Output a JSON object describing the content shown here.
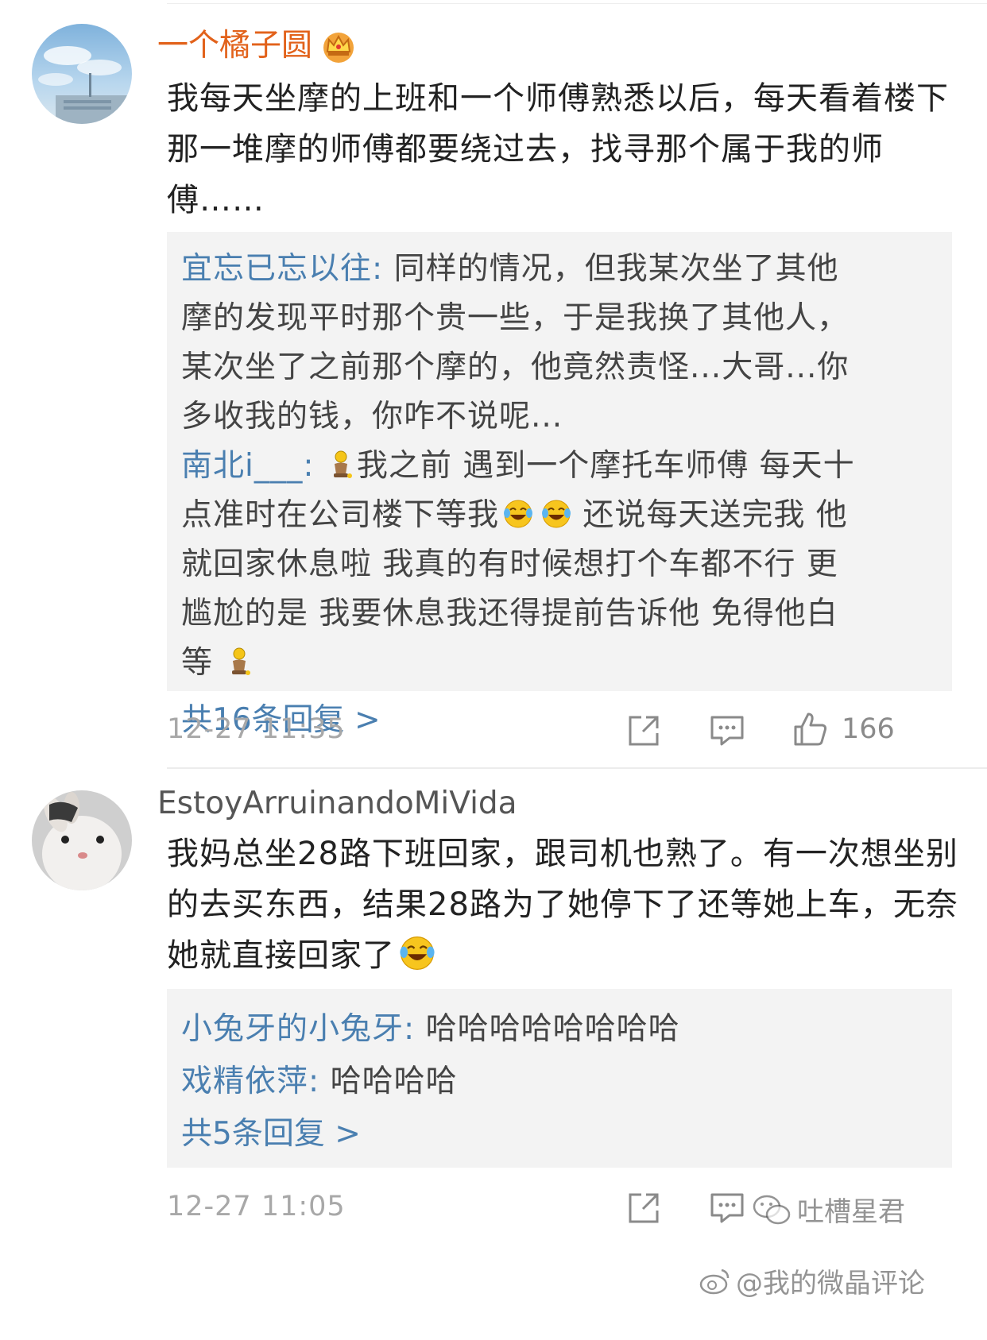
{
  "comments": [
    {
      "username": "一个橘子圆",
      "text": "我每天坐摩的上班和一个师傅熟悉以后，每天看着楼下那一堆摩的师傅都要绕过去，找寻那个属于我的师傅……",
      "replies": [
        {
          "name": "宜忘已忘以往",
          "sep": ": ",
          "text": "同样的情况，但我某次坐了其他摩的发现平时那个贵一些，于是我换了其他人，某次坐了之前那个摩的，他竟然责怪...大哥...你多收我的钱，你咋不说呢..."
        },
        {
          "name": "南北i___",
          "sep": ": ",
          "seg1": "我之前 遇到一个摩托车师傅 每天十点准时在公司楼下等我",
          "seg2": " 还说每天送完我 他就回家休息啦 我真的有时候想打个车都不行  更尴尬的是 我要休息我还得提前告诉他 免得他白等"
        }
      ],
      "more_replies": "共16条回复 >",
      "time": "12-27 11:35",
      "likes": "166"
    },
    {
      "username": "EstoyArruinandoMiVida",
      "text": "我妈总坐28路下班回家，跟司机也熟了。有一次想坐别的去买东西，结果28路为了她停下了还等她上车，无奈她就直接回家了",
      "replies": [
        {
          "name": "小兔牙的小兔牙",
          "sep": ": ",
          "text": "哈哈哈哈哈哈哈哈"
        },
        {
          "name": "戏精依萍",
          "sep": ": ",
          "text": "哈哈哈哈"
        }
      ],
      "more_replies": "共5条回复 >",
      "time": "12-27 11:05"
    }
  ],
  "watermark": {
    "line1": "吐槽星君",
    "line2": "@我的微晶评论"
  },
  "colors": {
    "username_vip": "#e2621b",
    "username_normal": "#555555",
    "link_blue": "#4a7fb0",
    "reply_bg": "#f3f3f3"
  }
}
